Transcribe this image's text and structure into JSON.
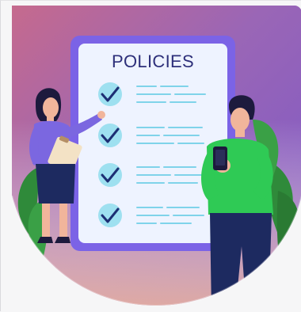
{
  "board": {
    "title": "POLICIES",
    "item_count": 4
  },
  "colors": {
    "background_gradient_top_left": "#c86a8b",
    "background_gradient_top_right": "#7a57c8",
    "background_gradient_bottom": "#f0b79a",
    "board_frame": "#7b63e6",
    "board_paper": "#eef3ff",
    "check_circle": "#9ee0f0",
    "check_mark": "#1d2f74",
    "text_lines": "#7fd3ea",
    "title_text": "#2d2f7a",
    "woman_top": "#7b67e0",
    "man_shirt": "#2fca55",
    "leaves": "#2f8a3a"
  },
  "icons": {
    "check": "check-icon",
    "clipboard": "clipboard-icon",
    "phone": "phone-icon"
  }
}
